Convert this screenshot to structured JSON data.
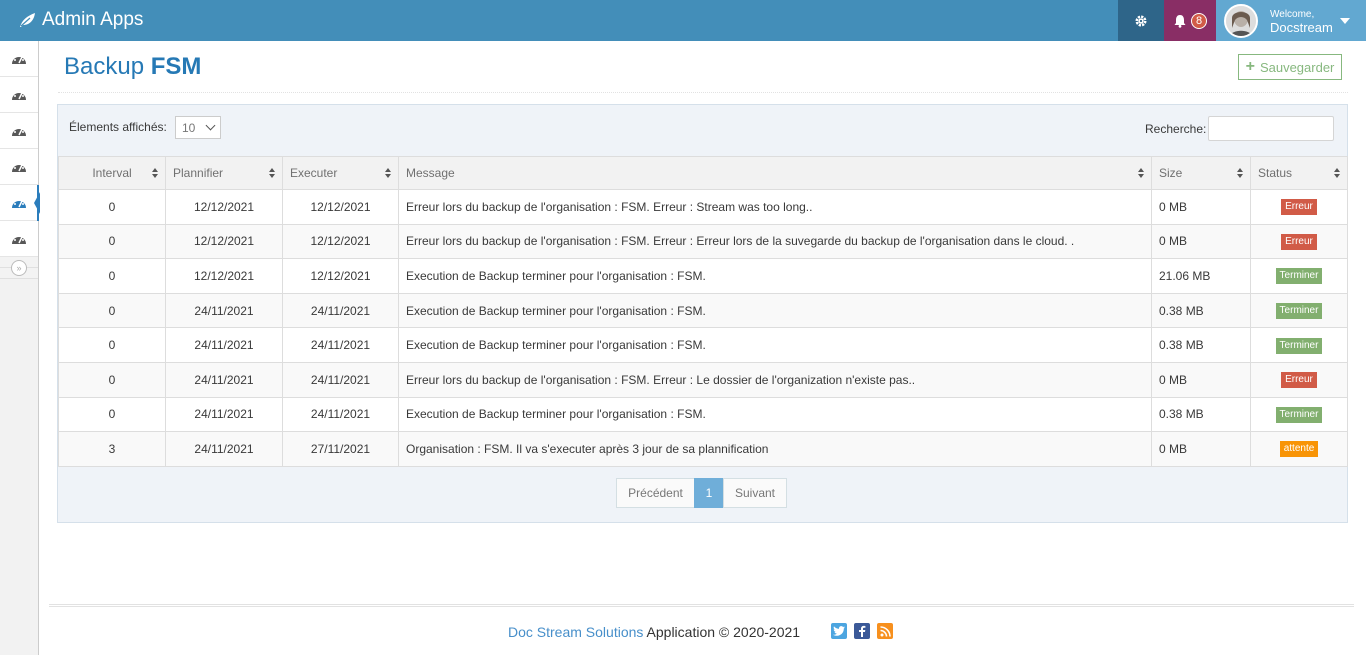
{
  "navbar": {
    "brand": "Admin Apps",
    "notification_count": "8",
    "user_welcome": "Welcome,",
    "user_name": "Docstream"
  },
  "page": {
    "title_prefix": "Backup",
    "title_bold": "FSM",
    "save_label": "Sauvegarder"
  },
  "table_controls": {
    "length_label": "Élements affichés:",
    "length_value": "10",
    "search_label": "Recherche:",
    "search_value": ""
  },
  "table": {
    "headers": [
      "Interval",
      "Plannifier",
      "Executer",
      "Message",
      "Size",
      "Status"
    ],
    "rows": [
      {
        "interval": "0",
        "planned": "12/12/2021",
        "executed": "12/12/2021",
        "message": "Erreur lors du backup de l'organisation : FSM. Erreur : Stream was too long..",
        "size": "0 MB",
        "status": "Erreur",
        "status_type": "danger"
      },
      {
        "interval": "0",
        "planned": "12/12/2021",
        "executed": "12/12/2021",
        "message": "Erreur lors du backup de l'organisation : FSM. Erreur : Erreur lors de la suvegarde du backup de l'organisation dans le cloud. .",
        "size": "0 MB",
        "status": "Erreur",
        "status_type": "danger"
      },
      {
        "interval": "0",
        "planned": "12/12/2021",
        "executed": "12/12/2021",
        "message": "Execution de Backup terminer pour l'organisation : FSM.",
        "size": "21.06 MB",
        "status": "Terminer",
        "status_type": "success"
      },
      {
        "interval": "0",
        "planned": "24/11/2021",
        "executed": "24/11/2021",
        "message": "Execution de Backup terminer pour l'organisation : FSM.",
        "size": "0.38 MB",
        "status": "Terminer",
        "status_type": "success"
      },
      {
        "interval": "0",
        "planned": "24/11/2021",
        "executed": "24/11/2021",
        "message": "Execution de Backup terminer pour l'organisation : FSM.",
        "size": "0.38 MB",
        "status": "Terminer",
        "status_type": "success"
      },
      {
        "interval": "0",
        "planned": "24/11/2021",
        "executed": "24/11/2021",
        "message": "Erreur lors du backup de l'organisation : FSM. Erreur : Le dossier de l'organization n'existe pas..",
        "size": "0 MB",
        "status": "Erreur",
        "status_type": "danger"
      },
      {
        "interval": "0",
        "planned": "24/11/2021",
        "executed": "24/11/2021",
        "message": "Execution de Backup terminer pour l'organisation : FSM.",
        "size": "0.38 MB",
        "status": "Terminer",
        "status_type": "success"
      },
      {
        "interval": "3",
        "planned": "24/11/2021",
        "executed": "27/11/2021",
        "message": "Organisation : FSM. Il va s'executer après 3 jour de sa plannification",
        "size": "0 MB",
        "status": "attente",
        "status_type": "warning"
      }
    ]
  },
  "pagination": {
    "prev": "Précédent",
    "current": "1",
    "next": "Suivant"
  },
  "footer": {
    "brand": "Doc Stream Solutions",
    "text": "Application © 2020-2021"
  },
  "sidebar": {
    "icons": [
      "tachometer-icon",
      "tachometer-icon",
      "tachometer-icon",
      "tachometer-icon",
      "tachometer-icon",
      "tachometer-icon"
    ],
    "active_index": 4
  },
  "colors": {
    "navbar": "#438eb9",
    "title": "#2679b5",
    "success": "#82af6f",
    "danger": "#d15b47",
    "warning": "#f89406"
  }
}
